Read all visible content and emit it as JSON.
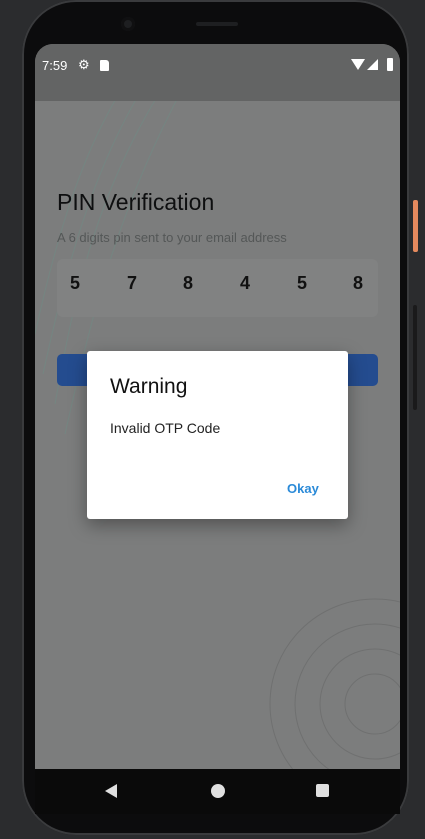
{
  "status_bar": {
    "time": "7:59",
    "icons": [
      "gear-icon",
      "sd-card-icon",
      "wifi-icon",
      "signal-icon",
      "battery-icon"
    ]
  },
  "screen": {
    "title": "PIN Verification",
    "subtitle": "A 6 digits pin sent to your email address",
    "pin_digits": [
      "5",
      "7",
      "8",
      "4",
      "5",
      "8"
    ]
  },
  "dialog": {
    "title": "Warning",
    "message": "Invalid OTP Code",
    "ok_label": "Okay",
    "ok_color": "#2a8ad8"
  },
  "nav_bar": {
    "icons": [
      "back-icon",
      "home-icon",
      "recents-icon"
    ]
  },
  "colors": {
    "scrim": "#7c7d7d",
    "verify_button": "#244c8f",
    "phone_accent": "#e58a5e"
  }
}
